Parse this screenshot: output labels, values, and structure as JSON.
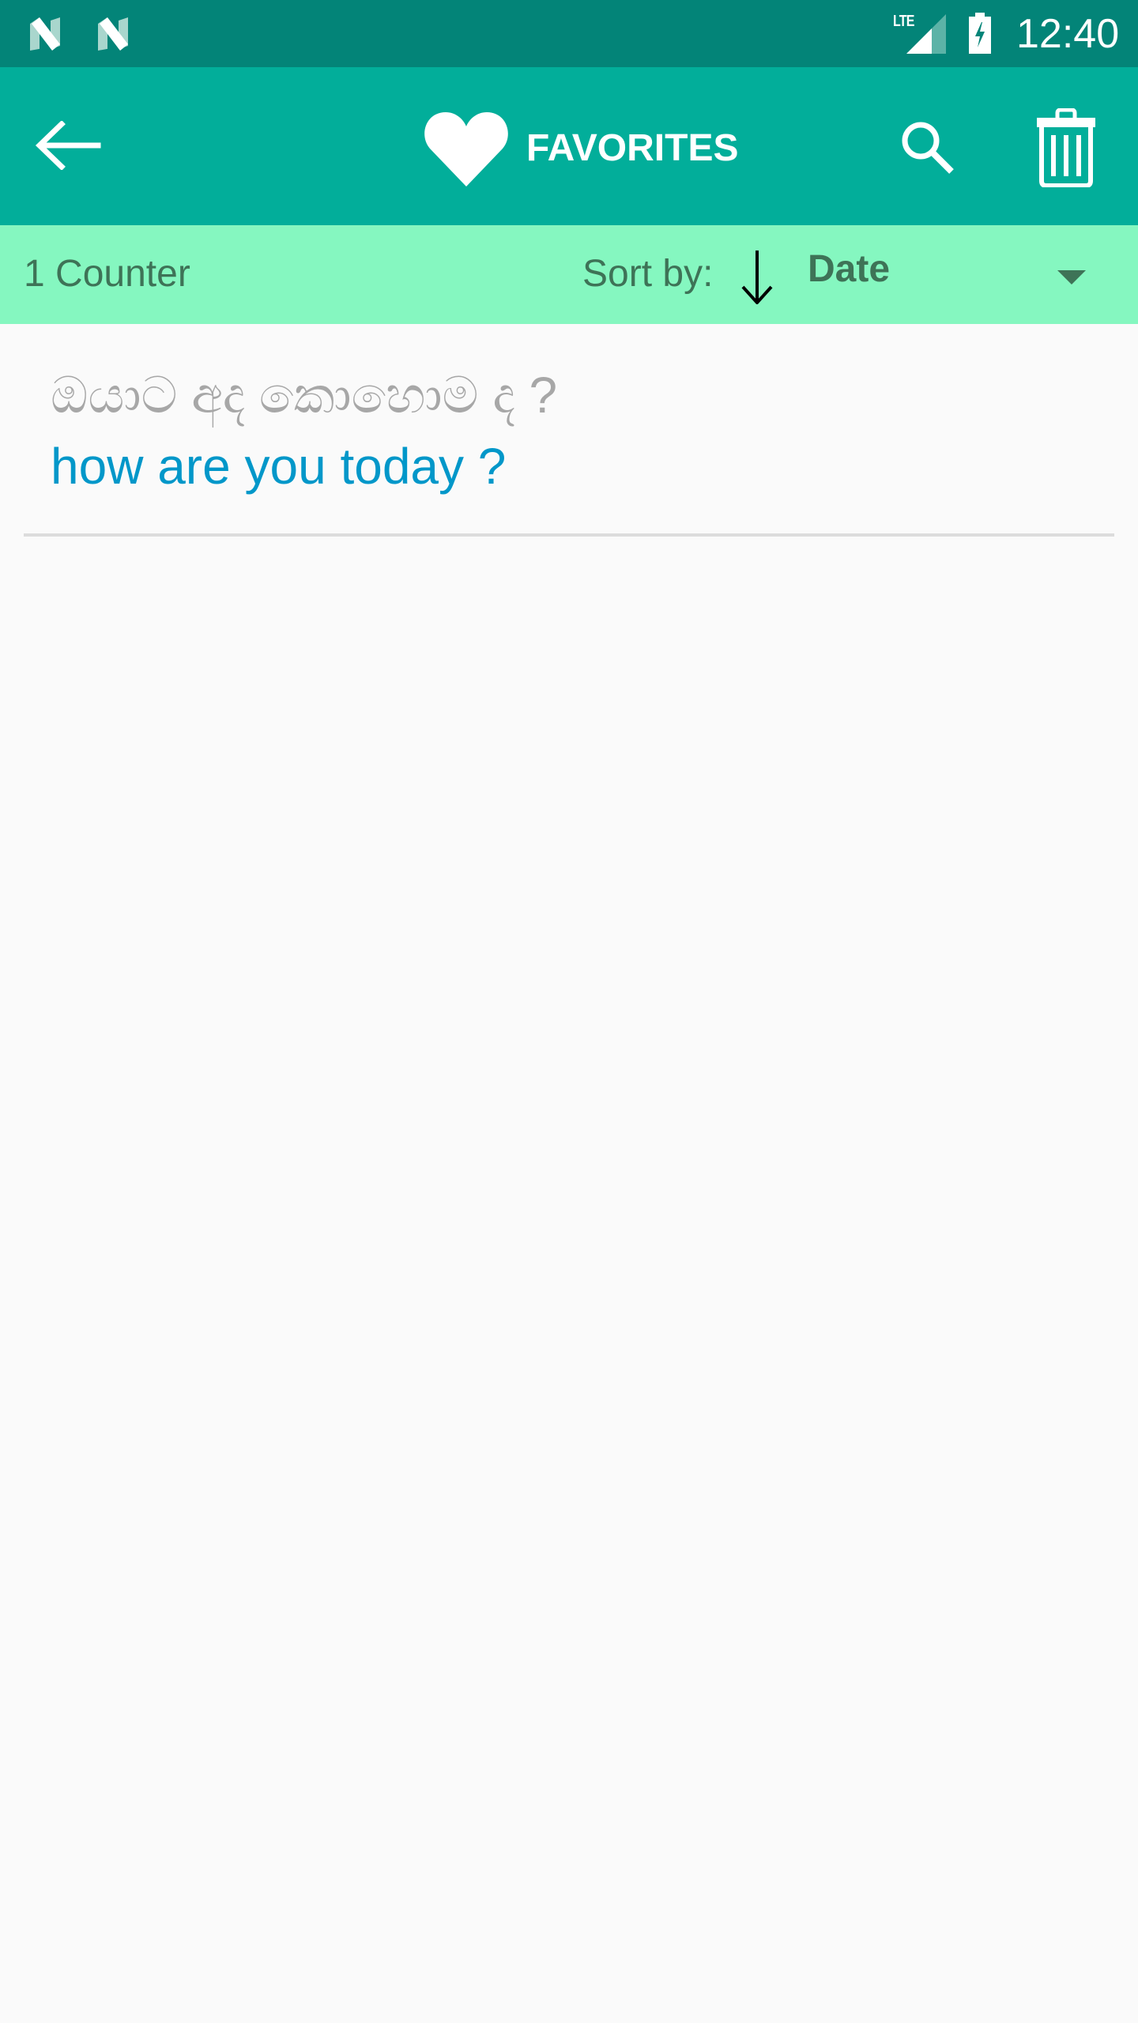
{
  "status_bar": {
    "notification_icons": [
      "n-notification-icon",
      "n-notification-icon"
    ],
    "network_type": "LTE",
    "signal_icon": "cellular-signal-icon",
    "battery_icon": "battery-charging-icon",
    "time": "12:40"
  },
  "app_bar": {
    "back_icon": "arrow-left-icon",
    "title_icon": "heart-icon",
    "title": "FAVORITES",
    "actions": [
      {
        "icon": "search-icon",
        "label": "Search"
      },
      {
        "icon": "trash-icon",
        "label": "Delete"
      }
    ]
  },
  "sort_bar": {
    "count": "1 Counter",
    "sort_label": "Sort by:",
    "sort_direction_icon": "arrow-down-icon",
    "sort_value": "Date"
  },
  "favorites": [
    {
      "source": "ඔයාට අද කොහොම ද ?",
      "translation": "how are you today ?"
    }
  ],
  "colors": {
    "status_bar": "#038478",
    "app_bar": "#02ae9a",
    "sort_bar": "#85f7c0",
    "sort_text": "#3e7357",
    "source_text": "#a7a7a7",
    "translation_text": "#0197c9",
    "background": "#fafafa"
  }
}
